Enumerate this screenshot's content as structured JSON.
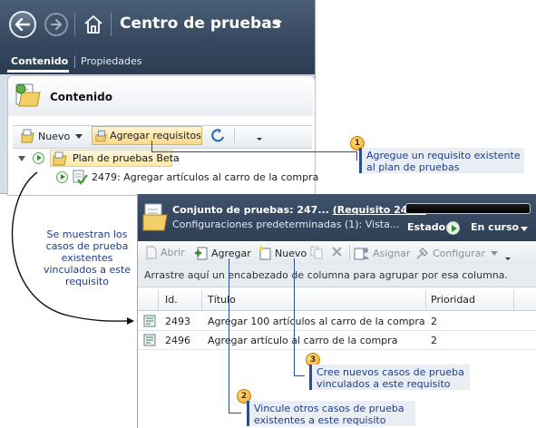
{
  "top_window": {
    "title": "Centro de pruebas",
    "tabs": [
      "Contenido",
      "Propiedades"
    ],
    "panel_title": "Contenido",
    "toolbar": {
      "new_label": "Nuevo",
      "add_requirements_label": "Agregar requisitos"
    },
    "tree": {
      "plan_label": "Plan de pruebas Beta",
      "child_label": "2479: Agregar artículos al carro de la compra"
    }
  },
  "bottom_window": {
    "suite_title_prefix": "Conjunto de pruebas:  247...",
    "suite_title_link": "(Requisito 2479)",
    "suite_subtitle": "Configuraciones predeterminadas (1): Vista...",
    "estado_label": "Estado:",
    "estado_value": "En curso",
    "toolbar": {
      "open_label": "Abrir",
      "add_label": "Agregar",
      "new_label": "Nuevo",
      "assign_label": "Asignar",
      "configure_label": "Configurar"
    },
    "group_hint": "Arrastre aquí un encabezado de columna para agrupar por esa columna.",
    "columns": [
      "Id.",
      "Título",
      "Prioridad"
    ],
    "rows": [
      {
        "id": "2493",
        "title": "Agregar 100 artículos al carro de la compra",
        "priority": "2"
      },
      {
        "id": "2496",
        "title": "Agregar artículo al carro de la compra",
        "priority": "2"
      }
    ]
  },
  "callouts": {
    "c1": {
      "number": "1",
      "line1": "Agregue un requisito existente",
      "line2": "al plan de pruebas"
    },
    "c2": {
      "number": "2",
      "line1": "Vincule otros casos de prueba",
      "line2": "existentes a este requisito"
    },
    "c3": {
      "number": "3",
      "line1": "Cree nuevos casos de prueba",
      "line2": "vinculados a este requisito"
    },
    "side_note": [
      "Se muestran los",
      "casos de prueba",
      "existentes",
      "vinculados a este",
      "requisito"
    ]
  },
  "colors": {
    "header_dark": "#33455c",
    "callout_blue": "#1f3c88",
    "callout_bubble": "#f3a21b",
    "selection_yellow": "#fde9a8"
  }
}
